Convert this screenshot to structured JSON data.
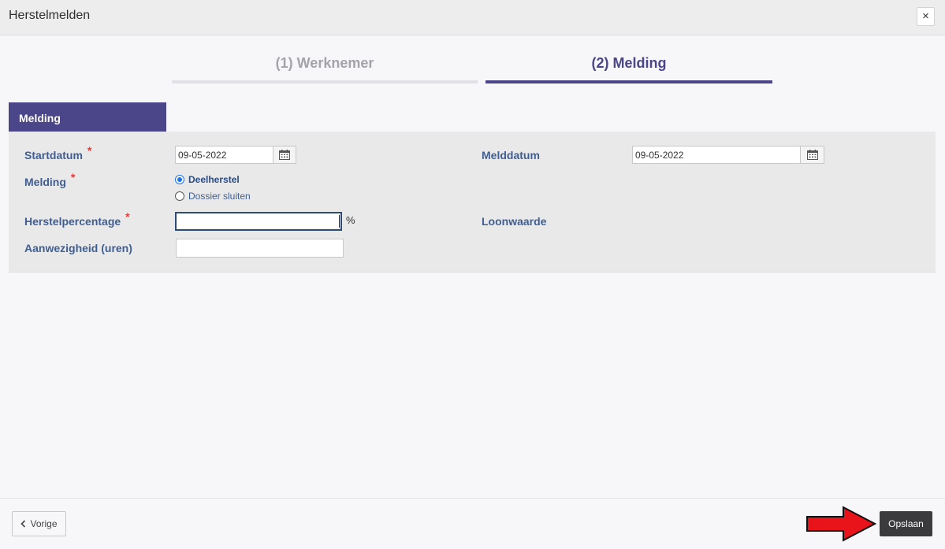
{
  "window": {
    "title": "Herstelmelden",
    "close_label": "×"
  },
  "steps": [
    {
      "label": "(1) Werknemer",
      "active": false
    },
    {
      "label": "(2) Melding",
      "active": true
    }
  ],
  "section": {
    "tab_label": "Melding"
  },
  "form": {
    "startdatum": {
      "label": "Startdatum",
      "required": "*",
      "value": "09-05-2022"
    },
    "melddatum": {
      "label": "Melddatum",
      "value": "09-05-2022"
    },
    "melding": {
      "label": "Melding",
      "required": "*",
      "options": [
        {
          "label": "Deelherstel",
          "checked": true
        },
        {
          "label": "Dossier sluiten",
          "checked": false
        }
      ]
    },
    "herstelpercentage": {
      "label": "Herstelpercentage",
      "required": "*",
      "value": "",
      "unit": "%"
    },
    "loonwaarde": {
      "label": "Loonwaarde"
    },
    "aanwezigheid": {
      "label": "Aanwezigheid (uren)",
      "value": ""
    }
  },
  "footer": {
    "prev_label": "Vorige",
    "save_label": "Opslaan"
  },
  "colors": {
    "accent": "#4a4689",
    "label": "#3f5e91",
    "required": "#e23b3b",
    "arrow": "#e8141a"
  },
  "icons": {
    "close": "close-icon",
    "calendar": "calendar-icon",
    "prev": "chevron-left-icon",
    "callout": "arrow-right-icon"
  }
}
